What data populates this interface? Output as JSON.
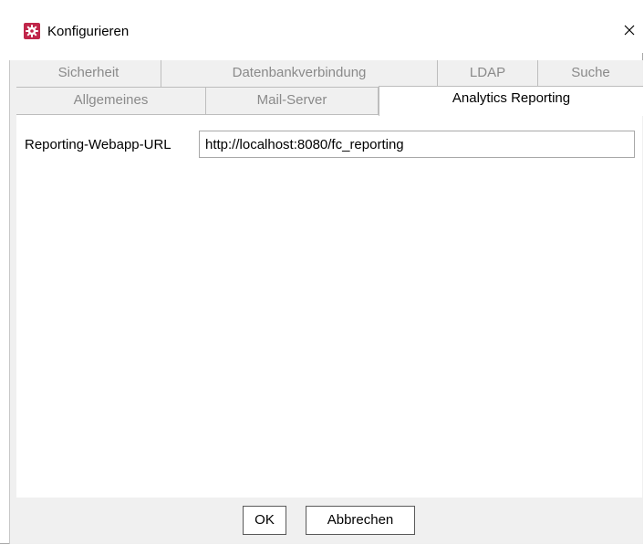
{
  "window": {
    "title": "Konfigurieren",
    "accent_color": "#c0264a"
  },
  "tabs": {
    "row1": [
      {
        "label": "Sicherheit"
      },
      {
        "label": "Datenbankverbindung"
      },
      {
        "label": "LDAP"
      },
      {
        "label": "Suche"
      }
    ],
    "row2": [
      {
        "label": "Allgemeines"
      },
      {
        "label": "Mail-Server"
      },
      {
        "label": "Analytics Reporting",
        "active": true
      }
    ]
  },
  "form": {
    "reporting_url_label": "Reporting-Webapp-URL",
    "reporting_url_value": "http://localhost:8080/fc_reporting"
  },
  "buttons": {
    "ok_label": "OK",
    "cancel_label": "Abbrechen"
  }
}
